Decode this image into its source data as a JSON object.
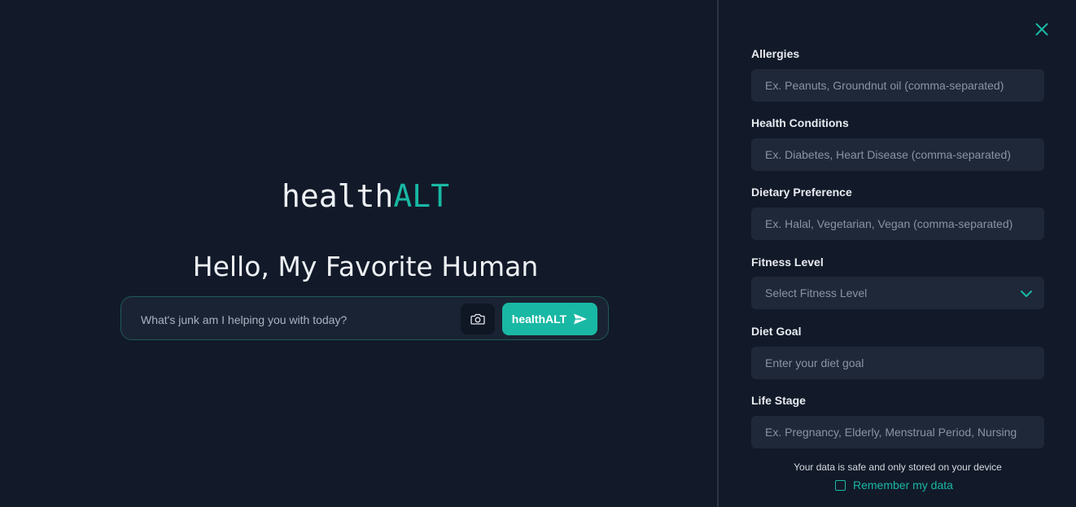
{
  "brand": {
    "part_a": "health",
    "part_b": "ALT"
  },
  "greeting": "Hello, My Favorite Human",
  "prompt": {
    "placeholder": "What's junk am I helping you with today?",
    "camera_icon": "camera-icon",
    "send_label": "healthALT",
    "send_icon": "send-arrow-icon"
  },
  "panel": {
    "close_icon": "close-icon",
    "allergies": {
      "label": "Allergies",
      "placeholder": "Ex. Peanuts, Groundnut oil (comma-separated)"
    },
    "health_conditions": {
      "label": "Health Conditions",
      "placeholder": "Ex. Diabetes, Heart Disease (comma-separated)"
    },
    "dietary_preference": {
      "label": "Dietary Preference",
      "placeholder": "Ex. Halal, Vegetarian, Vegan (comma-separated)"
    },
    "fitness_level": {
      "label": "Fitness Level",
      "selected": "Select Fitness Level"
    },
    "diet_goal": {
      "label": "Diet Goal",
      "placeholder": "Enter your diet goal"
    },
    "life_stage": {
      "label": "Life Stage",
      "placeholder": "Ex. Pregnancy, Elderly, Menstrual Period, Nursing"
    },
    "note": "Your data is safe and only stored on your device",
    "remember_label": "Remember my data",
    "remember_checked": false
  },
  "colors": {
    "background": "#121a29",
    "accent": "#19b8a4",
    "field_bg": "#1f2838"
  }
}
